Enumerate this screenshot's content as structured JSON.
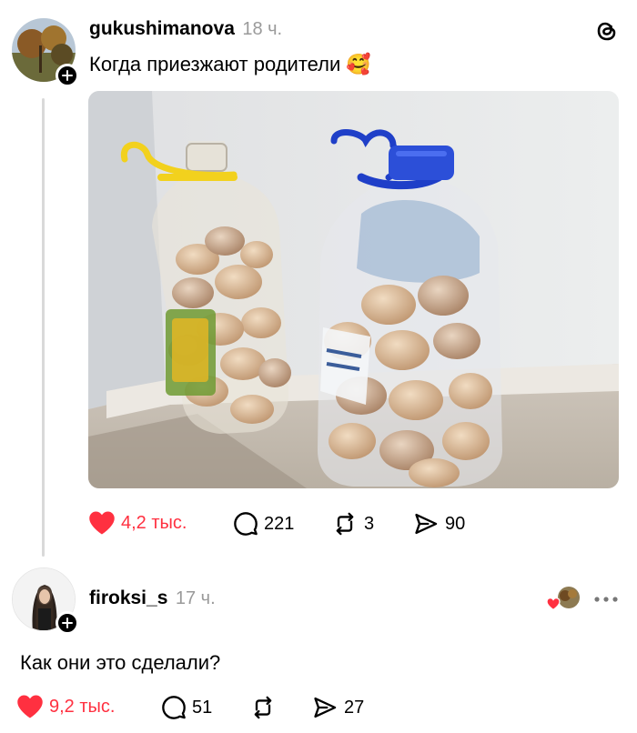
{
  "post": {
    "username": "gukushimanova",
    "time": "18 ч.",
    "text": "Когда приезжают родители 🥰",
    "actions": {
      "likes": "4,2 тыс.",
      "comments": "221",
      "reposts": "3",
      "shares": "90"
    }
  },
  "reply": {
    "username": "firoksi_s",
    "time": "17 ч.",
    "text": "Как они это сделали?",
    "actions": {
      "likes": "9,2 тыс.",
      "comments": "51",
      "shares": "27"
    }
  },
  "colors": {
    "like": "#ff3040",
    "muted": "#9a9a9a",
    "thread_line": "#d9d9d9"
  },
  "icons": [
    "threads-logo-icon",
    "heart-icon",
    "comment-icon",
    "repost-icon",
    "share-icon",
    "more-icon",
    "plus-icon"
  ]
}
